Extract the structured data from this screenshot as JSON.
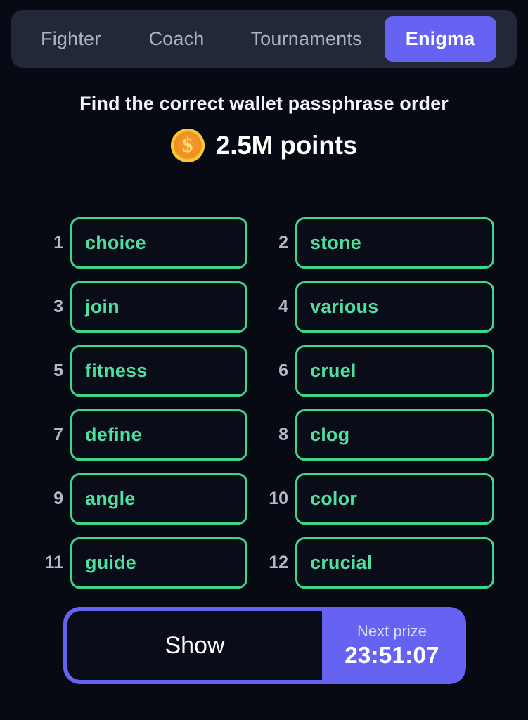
{
  "theme": {
    "page_bg": "#070a12",
    "tabbar_bg": "#232836",
    "accent_purple": "#6663f2",
    "word_green": "#4ee0a1",
    "word_border_green": "#3cd68c",
    "muted_text": "#aab3c4",
    "coin_gold": "#f6c933",
    "coin_orange": "#ef8f23"
  },
  "tabs": [
    {
      "label": "Fighter",
      "active": false
    },
    {
      "label": "Coach",
      "active": false
    },
    {
      "label": "Tournaments",
      "active": false
    },
    {
      "label": "Enigma",
      "active": true
    }
  ],
  "header": {
    "headline": "Find the correct wallet passphrase order",
    "coin_icon": "coin-dollar-icon",
    "coin_glyph": "$",
    "points": "2.5M points"
  },
  "passphrase": {
    "words": [
      {
        "index": "1",
        "word": "choice"
      },
      {
        "index": "2",
        "word": "stone"
      },
      {
        "index": "3",
        "word": "join"
      },
      {
        "index": "4",
        "word": "various"
      },
      {
        "index": "5",
        "word": "fitness"
      },
      {
        "index": "6",
        "word": "cruel"
      },
      {
        "index": "7",
        "word": "define"
      },
      {
        "index": "8",
        "word": "clog"
      },
      {
        "index": "9",
        "word": "angle"
      },
      {
        "index": "10",
        "word": "color"
      },
      {
        "index": "11",
        "word": "guide"
      },
      {
        "index": "12",
        "word": "crucial"
      }
    ]
  },
  "footer": {
    "show_label": "Show",
    "prize_label": "Next prize",
    "prize_timer": "23:51:07"
  }
}
